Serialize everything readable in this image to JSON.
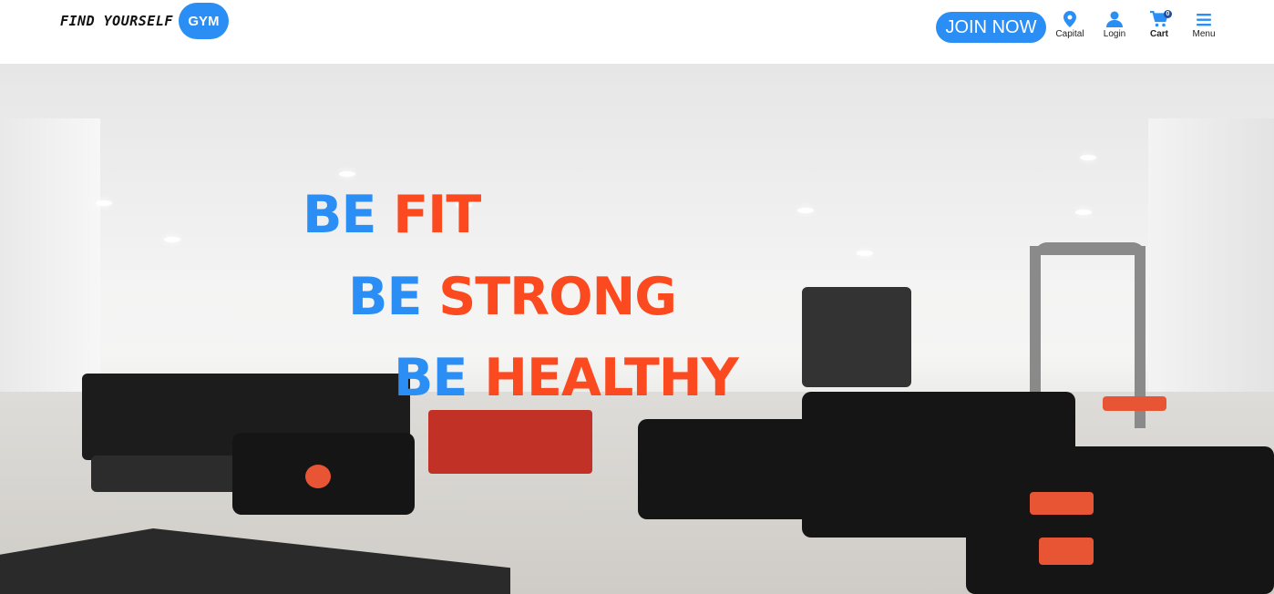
{
  "header": {
    "logo_text": "FIND YOURSELF",
    "logo_badge": "GYM",
    "join_label": "JOIN NOW",
    "nav": [
      {
        "label": "Capital",
        "icon": "location-pin-icon"
      },
      {
        "label": "Login",
        "icon": "user-icon"
      },
      {
        "label": "Cart",
        "icon": "cart-icon",
        "count": "0"
      },
      {
        "label": "Menu",
        "icon": "hamburger-menu-icon"
      }
    ]
  },
  "hero": {
    "lines": [
      {
        "lead": "BE",
        "word": "FIT"
      },
      {
        "lead": "BE",
        "word": "STRONG"
      },
      {
        "lead": "BE",
        "word": "HEALTHY"
      }
    ]
  },
  "colors": {
    "brand_blue": "#2b8ef4",
    "accent_orange": "#fb4a1f"
  }
}
